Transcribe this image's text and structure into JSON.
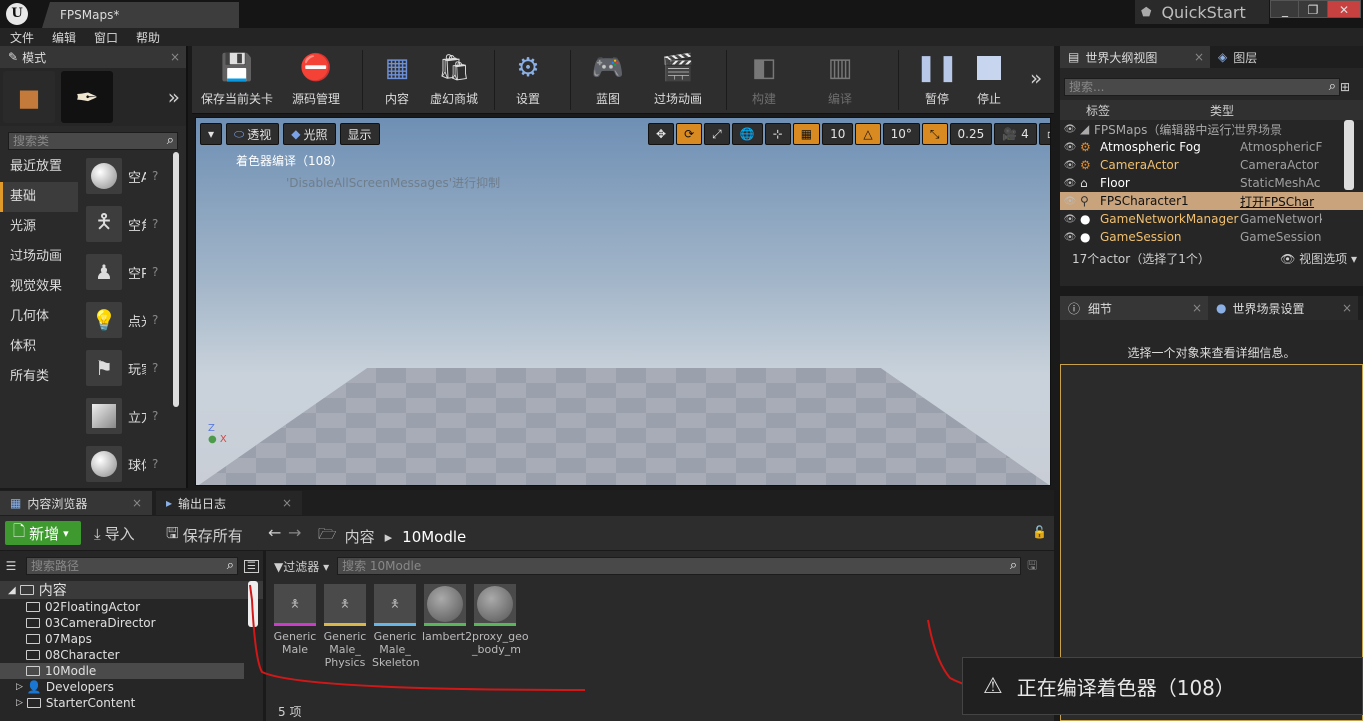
{
  "titlebar": {
    "tab_title": "FPSMaps*",
    "quickstart": "QuickStart"
  },
  "menu": [
    "文件",
    "编辑",
    "窗口",
    "帮助"
  ],
  "modes": {
    "tab": "模式",
    "search_placeholder": "搜索类",
    "categories": [
      "最近放置",
      "基础",
      "光源",
      "过场动画",
      "视觉效果",
      "几何体",
      "体积",
      "所有类"
    ],
    "items": [
      "空Actor",
      "空角色",
      "空Pawn",
      "点光源",
      "玩家起始",
      "立方体",
      "球体"
    ]
  },
  "toolbar": {
    "buttons": [
      "保存当前关卡",
      "源码管理",
      "内容",
      "虚幻商城",
      "设置",
      "蓝图",
      "过场动画",
      "构建",
      "编译",
      "暂停",
      "停止"
    ]
  },
  "viewport": {
    "perspective": "透视",
    "lighting": "光照",
    "show": "显示",
    "grid_snap": "10",
    "rot_snap": "10°",
    "scale_snap": "0.25",
    "camera_speed": "4",
    "msg_compile": "着色器编译（108）",
    "msg_suppressed": "'DisableAllScreenMessages'进行抑制"
  },
  "outliner": {
    "tab1": "世界大纲视图",
    "tab2": "图层",
    "search_placeholder": "搜索...",
    "col_label": "标签",
    "col_type": "类型",
    "rows": [
      {
        "name": "FPSMaps（编辑器中运行）",
        "type": "世界场景"
      },
      {
        "name": "Atmospheric Fog",
        "type": "AtmosphericF"
      },
      {
        "name": "CameraActor",
        "type": "CameraActor"
      },
      {
        "name": "Floor",
        "type": "StaticMeshAc"
      },
      {
        "name": "FPSCharacter1",
        "type": "打开FPSChar"
      },
      {
        "name": "GameNetworkManager",
        "type": "GameNetwork"
      },
      {
        "name": "GameSession",
        "type": "GameSession"
      }
    ],
    "footer": "17个actor（选择了1个）",
    "view_options": "视图选项"
  },
  "details": {
    "tab1": "细节",
    "tab2": "世界场景设置",
    "hint": "选择一个对象来查看详细信息。"
  },
  "content_browser": {
    "tab1": "内容浏览器",
    "tab2": "输出日志",
    "new": "新增",
    "import": "导入",
    "save_all": "保存所有",
    "crumb_root": "内容",
    "crumb_folder": "10Modle",
    "search_path": "搜索路径",
    "filters": "过滤器",
    "search_assets": "搜索 10Modle",
    "tree": [
      "内容",
      "02FloatingActor",
      "03CameraDirector",
      "07Maps",
      "08Character",
      "10Modle",
      "Developers",
      "StarterContent"
    ],
    "assets": [
      {
        "name": "Generic Male",
        "color": "#c93dc9"
      },
      {
        "name": "Generic Male_ Physics",
        "color": "#d8b84a"
      },
      {
        "name": "Generic Male_ Skeleton",
        "color": "#67b6e6"
      },
      {
        "name": "lambert2",
        "color": "#5bb55b"
      },
      {
        "name": "proxy_geo _body_m",
        "color": "#5bb55b"
      }
    ],
    "count": "5 项"
  },
  "toast": {
    "text": "正在编译着色器（108）"
  }
}
